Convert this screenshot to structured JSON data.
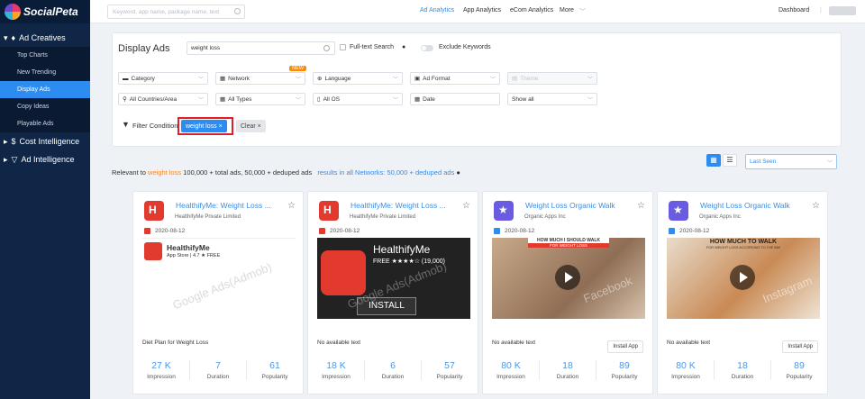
{
  "app": {
    "logo_text": "SocialPeta"
  },
  "sidebar": {
    "groups": [
      {
        "label": "Ad Creatives",
        "icon": "bulb-icon"
      },
      {
        "label": "Cost Intelligence",
        "icon": "dollar-icon"
      },
      {
        "label": "Ad Intelligence",
        "icon": "funnel-icon"
      }
    ],
    "items": [
      "Top Charts",
      "New Trending",
      "Display Ads",
      "Copy Ideas",
      "Playable Ads"
    ]
  },
  "topbar": {
    "search_placeholder": "Keyword, app name, package name, text",
    "nav": [
      "Ad Analytics",
      "App Analytics",
      "eCom Analytics",
      "More"
    ],
    "dashboard": "Dashboard"
  },
  "filters": {
    "title": "Display Ads",
    "query": "weight loss",
    "fulltext_label": "Full-text Search",
    "exclude_label": "Exclude Keywords",
    "row1": [
      "Category",
      "Network",
      "Language",
      "Ad Format",
      "Theme"
    ],
    "new_badge": "NEW",
    "row2": [
      "All Countries/Area",
      "All Types",
      "All OS",
      "Date",
      "Show all"
    ],
    "filter_condition_label": "Filter Condition",
    "active_tag": "weight loss ×",
    "clear_label": "Clear ×"
  },
  "results": {
    "prefix": "Relevant to ",
    "keyword": "weight loss",
    "summary": " 100,000 + total ads, 50,000 + deduped ads",
    "network_link": "results in all Networks: 50,000 + deduped ads",
    "sort_label": "Last Seen"
  },
  "cards": [
    {
      "title": "HealthifyMe: Weight Loss ...",
      "publisher": "HealthifyMe Private Limited",
      "date": "2020-08-12",
      "ad_text": "Diet Plan for Weight Loss",
      "install": "",
      "media_app": "HealthifyMe",
      "media_sub": "App Store | 4.7 ★ FREE",
      "watermark": "Google Ads(Admob)",
      "impression": "27 K",
      "duration": "7",
      "popularity": "61"
    },
    {
      "title": "HealthifyMe: Weight Loss ...",
      "publisher": "HealthifyMe Private Limited",
      "date": "2020-08-12",
      "ad_text": "No available text",
      "install": "",
      "media_app": "HealthifyMe",
      "media_sub": "FREE ★★★★☆ (19,000)",
      "media_cta": "INSTALL",
      "watermark": "Google Ads(Admob)",
      "impression": "18 K",
      "duration": "6",
      "popularity": "57"
    },
    {
      "title": "Weight Loss Organic Walk",
      "publisher": "Organic Apps Inc",
      "date": "2020-08-12",
      "ad_text": "No available text",
      "install": "Install App",
      "media_app": "HOW MUCH I SHOULD WALK",
      "media_sub": "FOR WEIGHT LOSS",
      "watermark": "Facebook",
      "impression": "80 K",
      "duration": "18",
      "popularity": "89"
    },
    {
      "title": "Weight Loss Organic Walk",
      "publisher": "Organic Apps Inc",
      "date": "2020-08-12",
      "ad_text": "No available text",
      "install": "Install App",
      "media_app": "HOW MUCH TO WALK",
      "media_sub": "FOR WEIGHT LOSS ACCORDING TO THE BMI",
      "watermark": "Instagram",
      "impression": "80 K",
      "duration": "18",
      "popularity": "89"
    }
  ],
  "stat_labels": [
    "Impression",
    "Duration",
    "Popularity"
  ],
  "colors": {
    "accent": "#2d8cf0",
    "sidebar": "#0f2647",
    "keyword": "#f08c2e"
  }
}
